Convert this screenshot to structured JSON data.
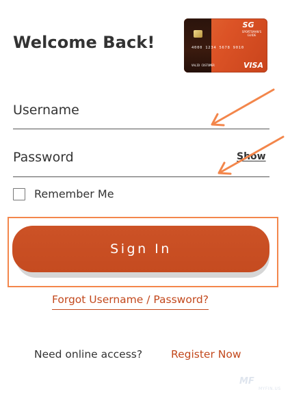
{
  "header": {
    "title": "Welcome Back!"
  },
  "card": {
    "logo": "SG",
    "brand_line1": "SPORTSMAN'S",
    "brand_line2": "GUIDE",
    "number": "4000 1234 5678 9010",
    "holder": "VALID CUSTOMER",
    "network": "VISA",
    "icon": "credit-card-image"
  },
  "form": {
    "username_label": "Username",
    "password_label": "Password",
    "show_label": "Show",
    "remember_label": "Remember Me",
    "remember_checked": false,
    "signin_label": "Sign In"
  },
  "links": {
    "forgot": "Forgot Username / Password?",
    "need_access": "Need online access?",
    "register": "Register Now"
  },
  "watermark": {
    "text": "MF",
    "sub": "MYFIN.US"
  },
  "colors": {
    "accent": "#c54b20",
    "link": "#c2481c",
    "arrow": "#f3864b",
    "highlight": "#f3864b"
  }
}
